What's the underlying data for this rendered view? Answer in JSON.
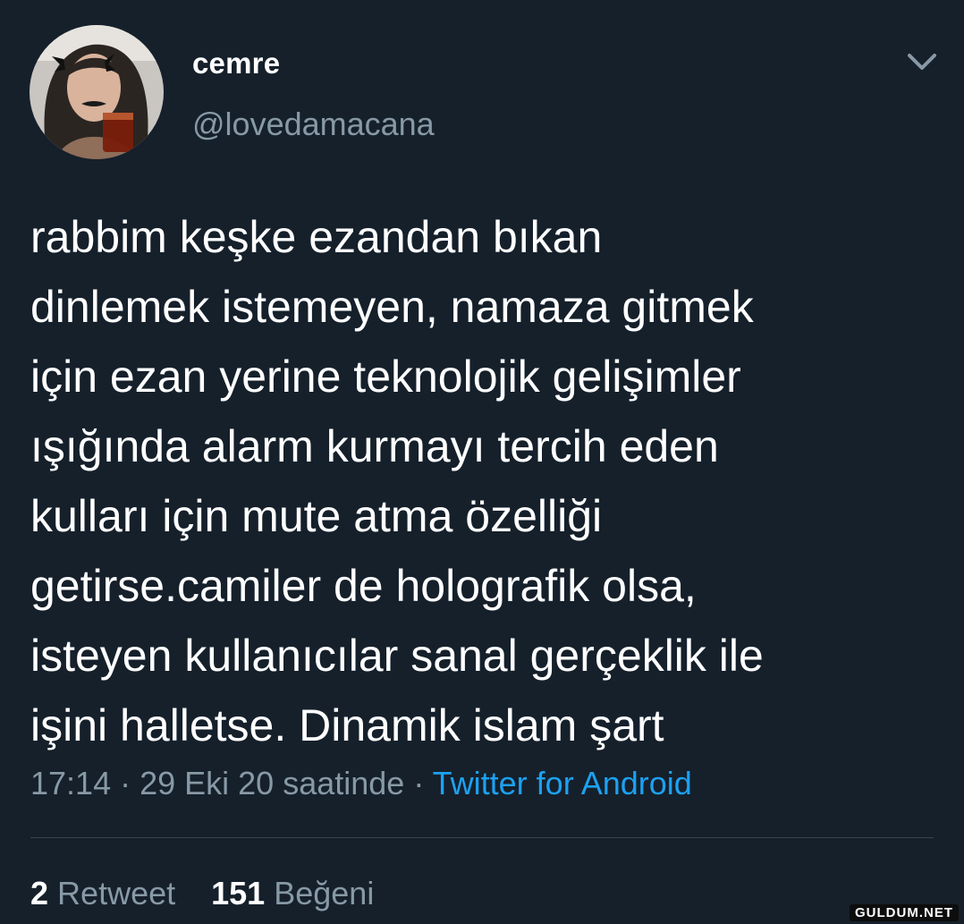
{
  "user": {
    "name": "cemre",
    "handle": "@lovedamacana",
    "avatar_icon": "profile-photo"
  },
  "menu_icon": "chevron-down-icon",
  "tweet": {
    "lines": [
      "rabbim keşke ezandan bıkan",
      "dinlemek istemeyen, namaza gitmek",
      "için ezan yerine teknolojik gelişimler",
      "ışığında alarm kurmayı tercih eden",
      "kulları için mute atma özelliği",
      "getirse.camiler de holografik olsa,",
      "isteyen kullanıcılar sanal gerçeklik ile",
      "işini halletse. Dinamik islam şart"
    ]
  },
  "meta": {
    "time": "17:14",
    "separator": " · ",
    "date": "29 Eki 20 saatinde",
    "separator2": " · ",
    "source": "Twitter for Android"
  },
  "stats": {
    "retweet_count": "2",
    "retweet_label": "Retweet",
    "like_count": "151",
    "like_label": "Beğeni"
  },
  "watermark": "GULDUM.NET",
  "colors": {
    "background": "#15202b",
    "secondary_text": "#8899a6",
    "link": "#1da1f2",
    "divider": "#38444d"
  }
}
